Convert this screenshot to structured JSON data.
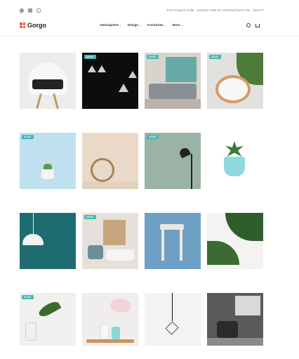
{
  "topbar": {
    "social_icons": [
      "twitter-icon",
      "facebook-icon",
      "instagram-icon"
    ],
    "promo_text": "Free Coupon Code : Summer Sale On Selected items Use : New 27"
  },
  "header": {
    "logo_text": "Gorgo",
    "logo_color": "#e15a2c",
    "nav": [
      {
        "label": "Atmosphere"
      },
      {
        "label": "Design"
      },
      {
        "label": "Furnitures"
      },
      {
        "label": "More"
      }
    ],
    "icons": [
      "user-icon",
      "cart-icon"
    ]
  },
  "sale_badge": "SALE!",
  "accent_color": "#46b6b1",
  "products": [
    {
      "image": "chair-with-folded-clothes",
      "sale": false
    },
    {
      "image": "black-pendant-lamps",
      "sale": true
    },
    {
      "image": "living-room-sofa",
      "sale": true
    },
    {
      "image": "white-chair-with-palm",
      "sale": true
    },
    {
      "image": "small-plant-pot-blue",
      "sale": true
    },
    {
      "image": "hanging-rattan-chair",
      "sale": false
    },
    {
      "image": "black-floor-lamp",
      "sale": true
    },
    {
      "image": "succulent-in-teal-pot",
      "sale": false
    },
    {
      "image": "white-pendant-lamp-teal-wall",
      "sale": false
    },
    {
      "image": "bright-living-room",
      "sale": true
    },
    {
      "image": "wooden-stool",
      "sale": false
    },
    {
      "image": "monstera-leaves",
      "sale": false
    },
    {
      "image": "palm-leaf-in-glass",
      "sale": true
    },
    {
      "image": "cherry-blossom-vases",
      "sale": false
    },
    {
      "image": "geometric-pendant-bulb",
      "sale": false
    },
    {
      "image": "dark-room-with-chair",
      "sale": false
    }
  ]
}
